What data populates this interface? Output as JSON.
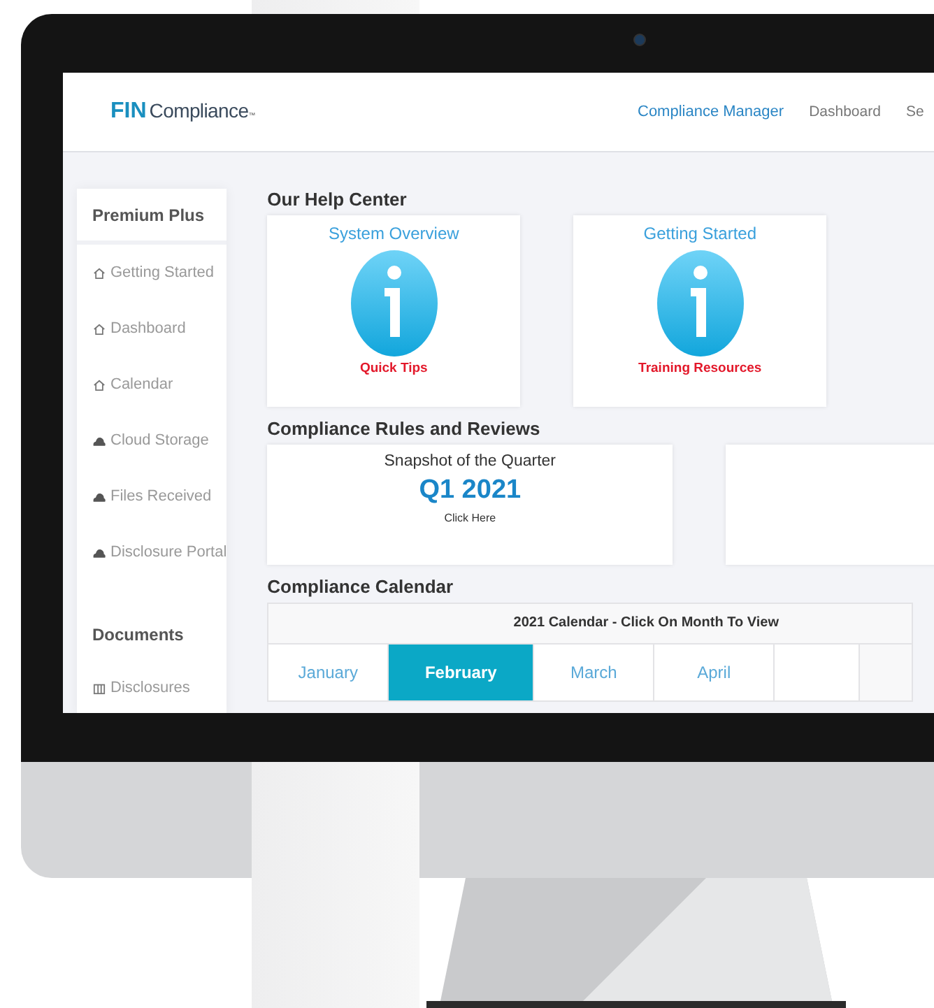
{
  "header": {
    "logo": {
      "mark": "FIN",
      "name": "Compliance",
      "tm": "™"
    },
    "nav": [
      {
        "label": "Compliance Manager",
        "selected": true
      },
      {
        "label": "Dashboard",
        "selected": false
      },
      {
        "label": "Se",
        "selected": false
      }
    ]
  },
  "sidebar": {
    "sections": [
      {
        "title": "Premium Plus",
        "items": [
          {
            "label": "Getting Started",
            "kind": "home"
          },
          {
            "label": "Dashboard",
            "kind": "home"
          },
          {
            "label": "Calendar",
            "kind": "home"
          },
          {
            "label": "Cloud Storage",
            "kind": "cloud"
          },
          {
            "label": "Files Received",
            "kind": "cloud"
          },
          {
            "label": "Disclosure Portal",
            "kind": "cloud"
          }
        ]
      },
      {
        "title": "Documents",
        "items": [
          {
            "label": "Disclosures",
            "kind": "columns"
          }
        ]
      }
    ]
  },
  "help_center": {
    "title": "Our Help Center",
    "cards": [
      {
        "title": "System Overview",
        "caption": "Quick Tips"
      },
      {
        "title": "Getting Started",
        "caption": "Training Resources"
      }
    ]
  },
  "rules": {
    "title": "Compliance Rules and Reviews",
    "snapshot": {
      "title": "Snapshot of the Quarter",
      "quarter": "Q1 2021",
      "link": "Click Here"
    }
  },
  "calendar": {
    "title": "Compliance Calendar",
    "heading": "2021 Calendar - Click On Month To View",
    "months": [
      {
        "label": "January",
        "selected": false
      },
      {
        "label": "February",
        "selected": true
      },
      {
        "label": "March",
        "selected": false
      },
      {
        "label": "April",
        "selected": false
      }
    ]
  }
}
